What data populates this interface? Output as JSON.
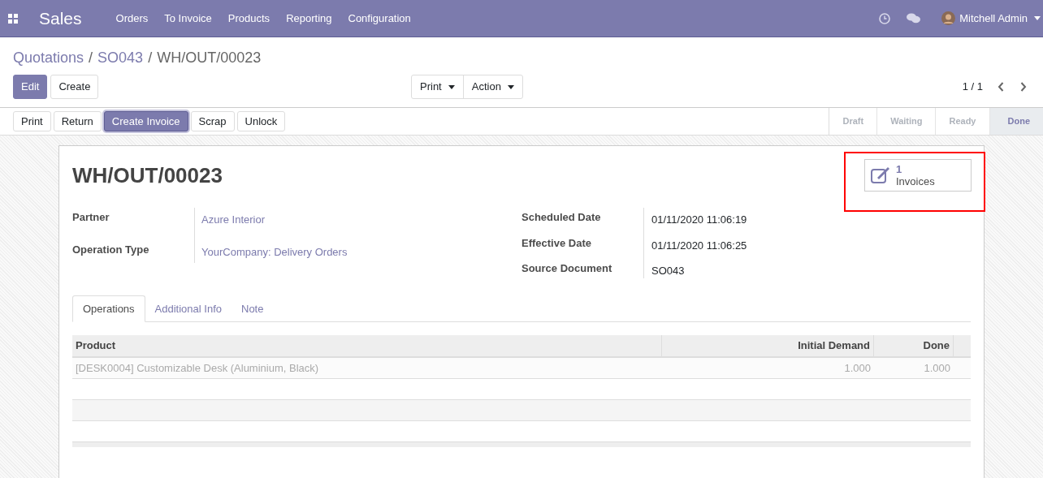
{
  "navbar": {
    "app": "Sales",
    "menu": [
      "Orders",
      "To Invoice",
      "Products",
      "Reporting",
      "Configuration"
    ],
    "user": "Mitchell Admin"
  },
  "breadcrumb": [
    {
      "label": "Quotations",
      "link": true
    },
    {
      "separator": "/",
      "label": "SO043",
      "link": true
    },
    {
      "separator": "/",
      "label": "WH/OUT/00023",
      "link": false
    }
  ],
  "control_buttons": [
    {
      "label": "Edit",
      "primary": true
    },
    {
      "label": "Create",
      "primary": false
    }
  ],
  "dropdowns": [
    "Print",
    "Action"
  ],
  "pager": "1 / 1",
  "header_buttons": [
    {
      "label": "Print",
      "primary": false
    },
    {
      "label": "Return",
      "primary": false
    },
    {
      "label": "Create Invoice",
      "primary": true
    },
    {
      "label": "Scrap",
      "primary": false
    },
    {
      "label": "Unlock",
      "primary": false
    }
  ],
  "stages": [
    {
      "label": "Draft",
      "selected": false
    },
    {
      "label": "Waiting",
      "selected": false
    },
    {
      "label": "Ready",
      "selected": false
    },
    {
      "label": "Done",
      "selected": true
    }
  ],
  "smart_button": {
    "count": "1",
    "label": "Invoices",
    "highlighted": true
  },
  "title": "WH/OUT/00023",
  "left_fields": [
    {
      "label": "Partner",
      "value": "Azure Interior",
      "link": true
    },
    {
      "label": "Operation Type",
      "value": "YourCompany: Delivery Orders",
      "link": true
    }
  ],
  "right_fields": [
    {
      "label": "Scheduled Date",
      "value": "01/11/2020 11:06:19",
      "link": false
    },
    {
      "label": "Effective Date",
      "value": "01/11/2020 11:06:25",
      "link": false
    },
    {
      "label": "Source Document",
      "value": "SO043",
      "link": false
    }
  ],
  "tabs": [
    {
      "label": "Operations",
      "selected": true
    },
    {
      "label": "Additional Info",
      "selected": false
    },
    {
      "label": "Note",
      "selected": false
    }
  ],
  "table": {
    "columns": [
      "Product",
      "Initial Demand",
      "Done"
    ],
    "rows": [
      {
        "cells": [
          "[DESK0004] Customizable Desk (Aluminium, Black)",
          "1.000",
          "1.000"
        ],
        "disabled": true
      }
    ]
  }
}
